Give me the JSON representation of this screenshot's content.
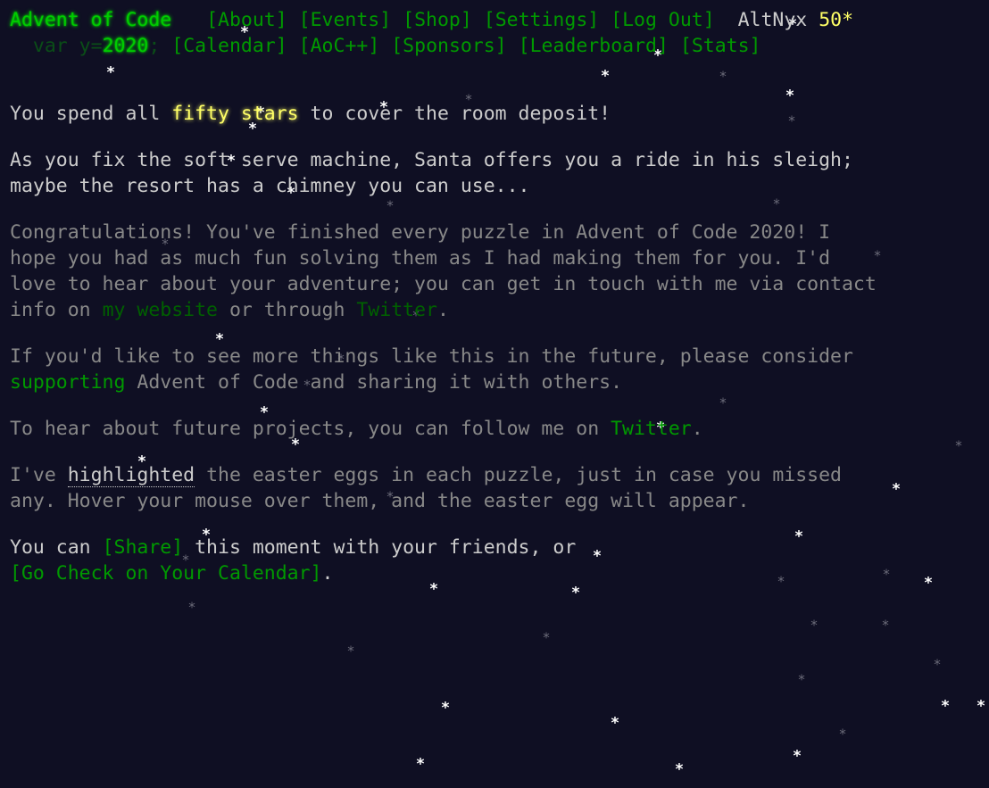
{
  "header": {
    "title": "Advent of Code",
    "year_prefix": "var y=",
    "year": "2020",
    "year_suffix": ";",
    "nav_row1": [
      "[About]",
      "[Events]",
      "[Shop]",
      "[Settings]",
      "[Log Out]"
    ],
    "user": "AltNyx",
    "stars": "50*",
    "nav_row2": [
      "[Calendar]",
      "[AoC++]",
      "[Sponsors]",
      "[Leaderboard]",
      "[Stats]"
    ]
  },
  "main": {
    "p1_a": "You spend all ",
    "p1_gold": "fifty stars",
    "p1_b": " to cover the room deposit!",
    "p2_line1": "As you fix the soft serve machine, Santa offers you a ride in his sleigh;",
    "p2_line2": "maybe the resort has a chimney you can use...",
    "p3_line1": "Congratulations! You've finished every puzzle in Advent of Code 2020! I",
    "p3_line2": "hope you had as much fun solving them as I had making them for you. I'd",
    "p3_line3": "love to hear about your adventure; you can get in touch with me via contact",
    "p3_a": "info on ",
    "p3_link_website": "my website",
    "p3_b": " or through ",
    "p3_link_twitter": "Twitter",
    "p3_c": ".",
    "p4_line1": "If you'd like to see more things like this in the future, please consider",
    "p4_link": "supporting",
    "p4_b": " Advent of Code and sharing it with others.",
    "p5_a": "To hear about future projects, you can follow me on ",
    "p5_link": "Twitter",
    "p5_b": ".",
    "p6_a": "I've ",
    "p6_hl": "highlighted",
    "p6_b": " the easter eggs in each puzzle, just in case you missed",
    "p6_line2": "any. Hover your mouse over them, and the easter egg will appear.",
    "p7_a": "You can ",
    "p7_share": "[Share]",
    "p7_b": " this moment with your friends, or",
    "p7_calendar": "[Go Check on Your Calendar]",
    "p7_c": "."
  },
  "decor": {
    "star_glyph": "*",
    "colors": {
      "background": "#0f0f23",
      "text": "#cccccc",
      "link": "#009900",
      "title": "#00cc00",
      "gold": "#ffff66",
      "quiet": "#888888"
    }
  }
}
